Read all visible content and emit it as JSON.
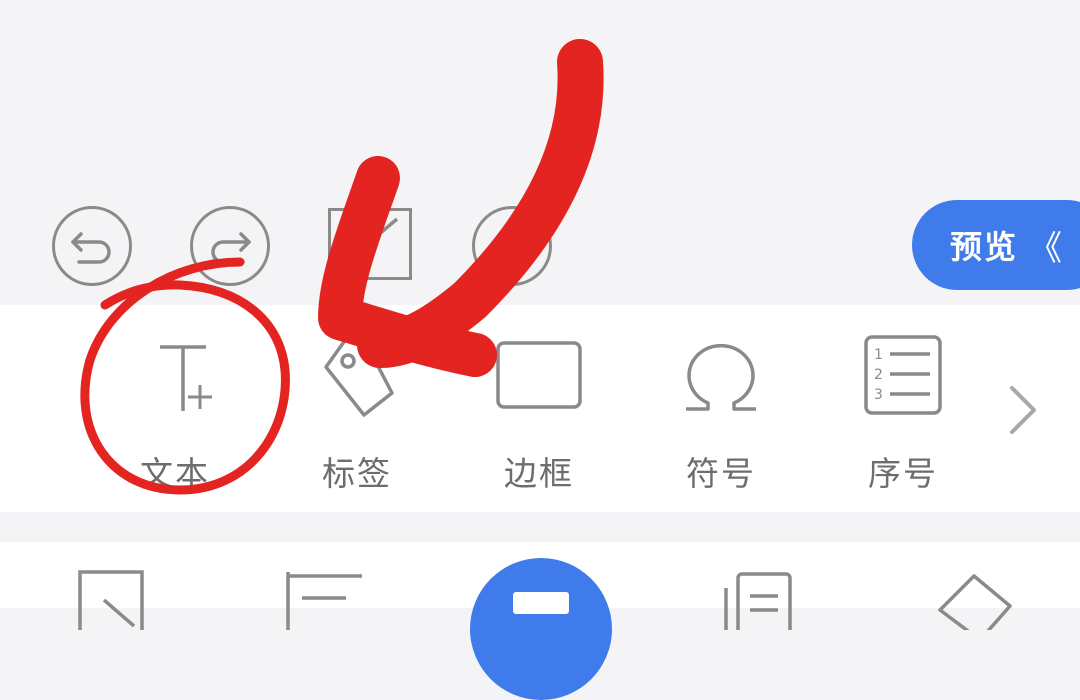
{
  "toolbar_top": {
    "preview_label": "预览",
    "preview_chevron": "《",
    "icons": [
      "undo-icon",
      "redo-icon",
      "edit-icon",
      "add-icon"
    ]
  },
  "tools": [
    {
      "id": "text",
      "label": "文本",
      "icon": "text-add-icon"
    },
    {
      "id": "tag",
      "label": "标签",
      "icon": "tag-icon"
    },
    {
      "id": "border",
      "label": "边框",
      "icon": "border-icon"
    },
    {
      "id": "symbol",
      "label": "符号",
      "icon": "omega-icon"
    },
    {
      "id": "number",
      "label": "序号",
      "icon": "numbered-list-icon"
    }
  ],
  "bottom_bar": {
    "icons": [
      "export-icon",
      "align-icon",
      "print-icon",
      "copy-icon",
      "eraser-icon"
    ]
  },
  "colors": {
    "accent": "#3f7bea",
    "annotation": "#e32420",
    "icon": "#8a8a8a",
    "label": "#6d6d6d",
    "background": "#f4f4f6"
  }
}
